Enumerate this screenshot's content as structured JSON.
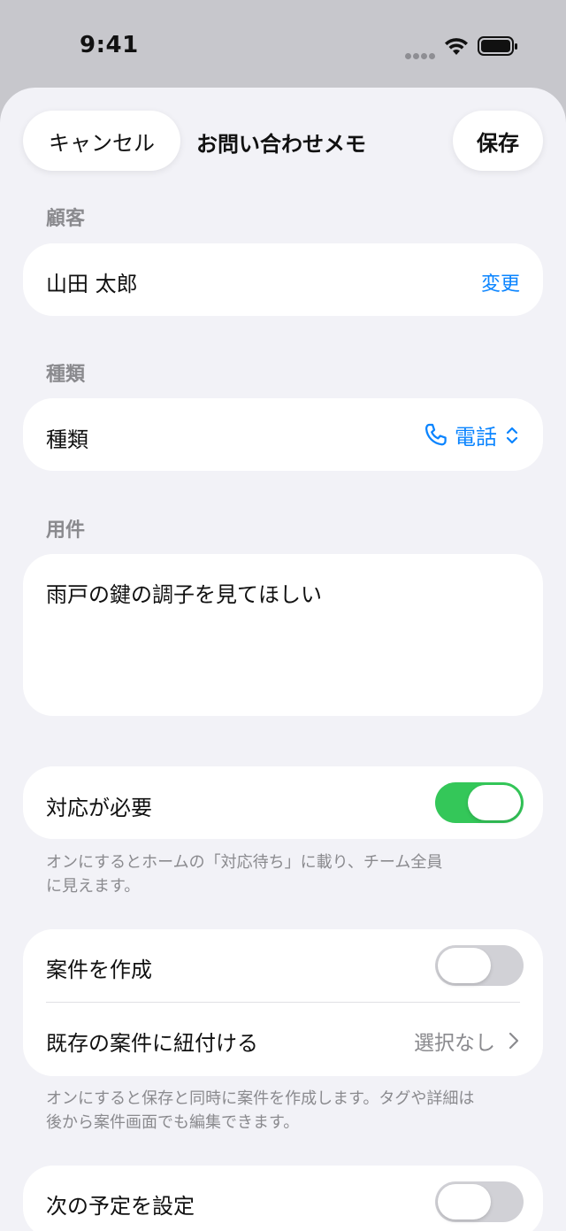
{
  "status_bar": {
    "time": "9:41"
  },
  "nav": {
    "cancel_label": "キャンセル",
    "title": "お問い合わせメモ",
    "save_label": "保存"
  },
  "customer": {
    "header": "顧客",
    "name": "山田 太郎",
    "change_label": "変更"
  },
  "type": {
    "header": "種類",
    "row_label": "種類",
    "selected_value": "電話",
    "icon": "phone-icon"
  },
  "subject": {
    "header": "用件",
    "text": "雨戸の鍵の調子を見てほしい"
  },
  "action_required": {
    "label": "対応が必要",
    "enabled": true,
    "footnote_line1": "オンにするとホームの「対応待ち」に載り、チーム全員",
    "footnote_line2": "に見えます。"
  },
  "case": {
    "create_label": "案件を作成",
    "create_enabled": false,
    "link_label": "既存の案件に紐付ける",
    "link_value": "選択なし",
    "footnote_line1": "オンにすると保存と同時に案件を作成します。タグや詳細は",
    "footnote_line2": "後から案件画面でも編集できます。"
  },
  "next_schedule": {
    "label": "次の予定を設定",
    "enabled": false
  },
  "colors": {
    "accent": "#0a84ff",
    "toggle_on": "#34c759",
    "toggle_off": "#d1d1d6",
    "background": "#f2f2f7"
  }
}
